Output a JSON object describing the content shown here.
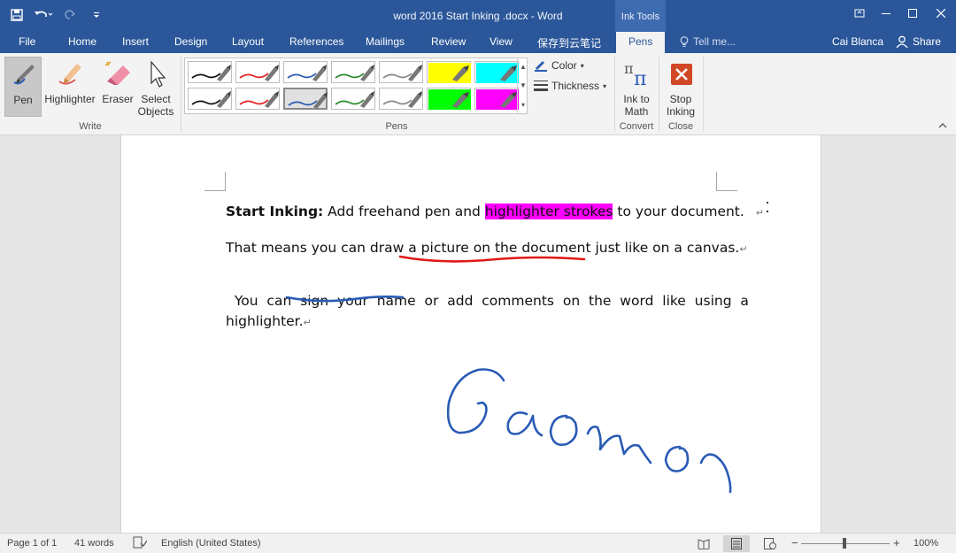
{
  "app": {
    "title": "word 2016 Start Inking .docx - Word",
    "context_tab": "Ink Tools"
  },
  "tabs": {
    "file": "File",
    "home": "Home",
    "insert": "Insert",
    "design": "Design",
    "layout": "Layout",
    "references": "References",
    "mailings": "Mailings",
    "review": "Review",
    "view": "View",
    "cloud": "保存到云笔记",
    "pens": "Pens",
    "tellme": "Tell me...",
    "user": "Cai Blanca",
    "share": "Share"
  },
  "ribbon": {
    "write": {
      "label": "Write",
      "pen": "Pen",
      "highlighter": "Highlighter",
      "eraser": "Eraser",
      "select": "Select",
      "select2": "Objects"
    },
    "pens": {
      "label": "Pens",
      "color": "Color",
      "thickness": "Thickness"
    },
    "convert": {
      "label": "Convert",
      "ink1": "Ink to",
      "ink2": "Math"
    },
    "close": {
      "label": "Close",
      "stop1": "Stop",
      "stop2": "Inking"
    }
  },
  "pen_swatches": [
    {
      "color": "#111111",
      "type": "pen"
    },
    {
      "color": "#e02020",
      "type": "pen"
    },
    {
      "color": "#2a5bb5",
      "type": "pen"
    },
    {
      "color": "#2e8b2e",
      "type": "pen"
    },
    {
      "color": "#888888",
      "type": "pen"
    },
    {
      "color": "#ffff00",
      "type": "highlighter"
    },
    {
      "color": "#00ffff",
      "type": "highlighter"
    },
    {
      "color": "#111111",
      "type": "pen"
    },
    {
      "color": "#e02020",
      "type": "pen"
    },
    {
      "color": "#2a5bb5",
      "type": "pen",
      "selected": true
    },
    {
      "color": "#2e8b2e",
      "type": "pen"
    },
    {
      "color": "#888888",
      "type": "pen"
    },
    {
      "color": "#00ff00",
      "type": "highlighter"
    },
    {
      "color": "#ff00ff",
      "type": "highlighter"
    }
  ],
  "document": {
    "p1_bold": "Start Inking:",
    "p1_a": " Add freehand pen and ",
    "p1_hl": "highlighter strokes",
    "p1_b": " to your document.",
    "p2_a": "That means you can draw a picture on the document just like on a canvas.",
    "p3_a": "You  can  sign  your  name  or  add  comments  on  the  word  like  using  a",
    "p3_b": "highlighter.",
    "para_mark": "↵",
    "signature": "Gaomon"
  },
  "status": {
    "page": "Page 1 of 1",
    "words": "41 words",
    "language": "English (United States)",
    "zoom": "100%",
    "zoom_minus": "−",
    "zoom_plus": "+"
  }
}
